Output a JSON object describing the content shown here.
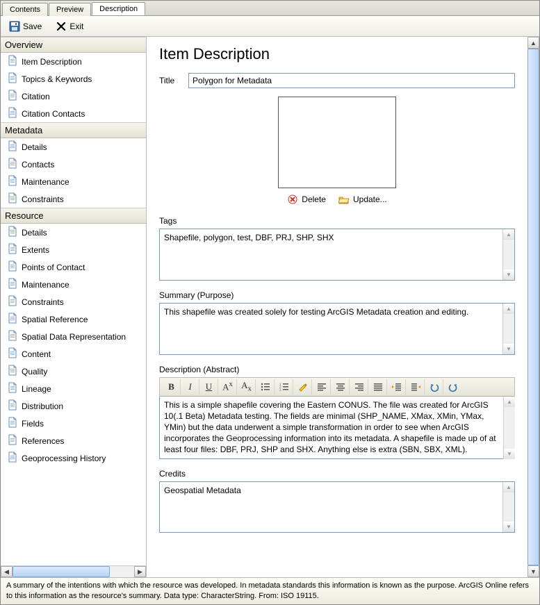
{
  "tabs": {
    "contents": "Contents",
    "preview": "Preview",
    "description": "Description"
  },
  "toolbar": {
    "save": "Save",
    "exit": "Exit"
  },
  "sidebar": {
    "overview": {
      "header": "Overview",
      "items": [
        "Item Description",
        "Topics & Keywords",
        "Citation",
        "Citation Contacts"
      ]
    },
    "metadata": {
      "header": "Metadata",
      "items": [
        "Details",
        "Contacts",
        "Maintenance",
        "Constraints"
      ]
    },
    "resource": {
      "header": "Resource",
      "items": [
        "Details",
        "Extents",
        "Points of Contact",
        "Maintenance",
        "Constraints",
        "Spatial Reference",
        "Spatial Data Representation",
        "Content",
        "Quality",
        "Lineage",
        "Distribution",
        "Fields",
        "References",
        "Geoprocessing History"
      ]
    }
  },
  "page": {
    "heading": "Item Description",
    "title_label": "Title",
    "title_value": "Polygon for Metadata",
    "thumb_delete": "Delete",
    "thumb_update": "Update...",
    "tags_label": "Tags",
    "tags_value": "Shapefile, polygon, test, DBF, PRJ, SHP, SHX",
    "summary_label": "Summary (Purpose)",
    "summary_value": "This shapefile was created solely for testing ArcGIS Metadata creation and editing.",
    "desc_label": "Description (Abstract)",
    "desc_value": "This is a simple shapefile covering the Eastern CONUS. The file was created for ArcGIS 10(.1 Beta) Metadata testing. The fields are minimal (SHP_NAME, XMax, XMin, YMax, YMin) but the data underwent a simple transformation in order to see when ArcGIS incorporates the Geoprocessing information into its metadata. A shapefile is made up of at least four files: DBF, PRJ, SHP and SHX. Anything else is extra (SBN, SBX, XML).",
    "credits_label": "Credits",
    "credits_value": "Geospatial Metadata"
  },
  "rte": {
    "bold": "B",
    "italic": "I",
    "underline": "U",
    "sup": "Aˣ",
    "sub": "Aₓ"
  },
  "statusbar": "A summary of the intentions with which the resource was developed. In metadata standards this information is known as the purpose. ArcGIS Online refers to this information as the resource's summary. Data type: CharacterString. From: ISO 19115."
}
